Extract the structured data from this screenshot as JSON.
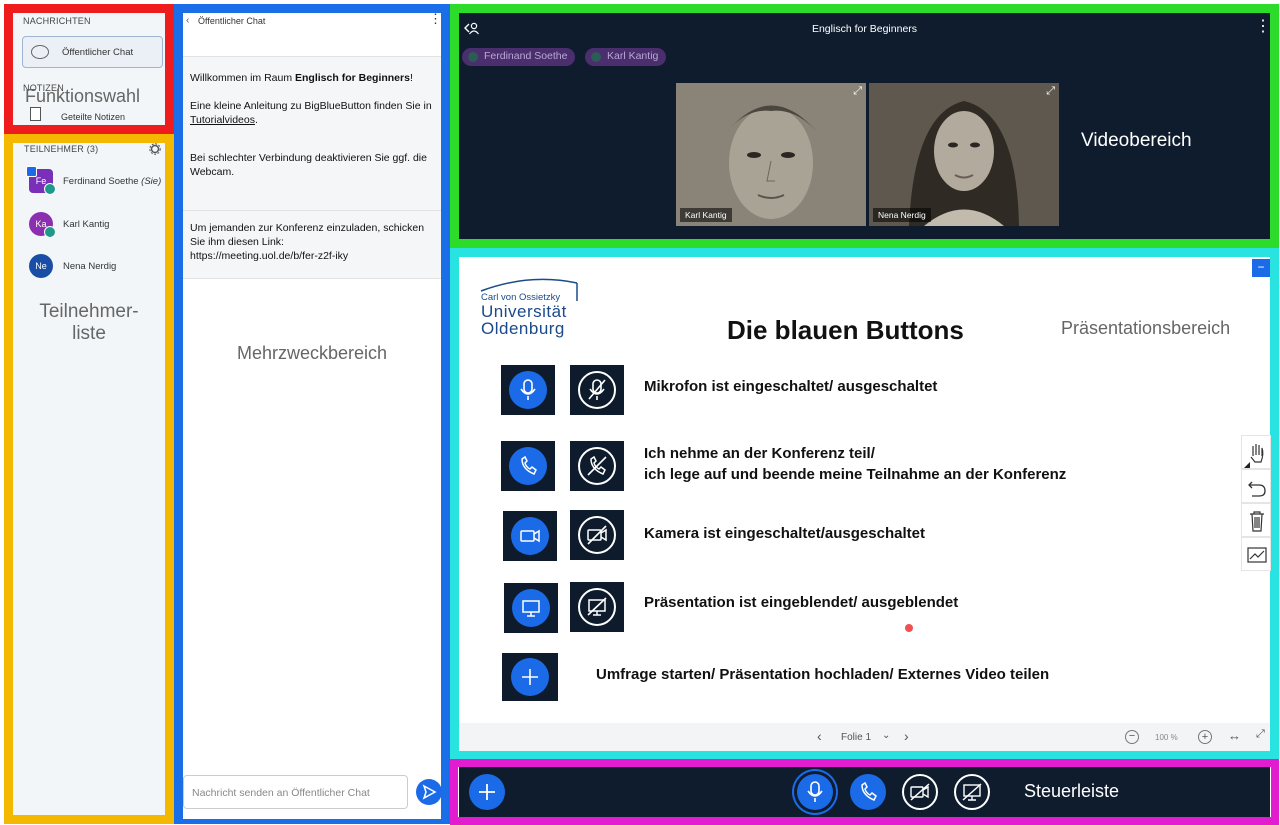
{
  "nav": {
    "messages_title": "NACHRICHTEN",
    "public_chat": "Öffentlicher Chat",
    "notes_title": "NOTIZEN",
    "shared_notes": "Geteilte Notizen",
    "overlay_label": "Funktionswahl",
    "participants_title": "TEILNEHMER (3)",
    "participants_label": "Teilnehmer-\nliste",
    "users": [
      {
        "initials": "Fe",
        "name": "Ferdinand Soethe",
        "suffix": "(Sie)",
        "color": "#7a2fb8"
      },
      {
        "initials": "Ka",
        "name": "Karl Kantig",
        "suffix": "",
        "color": "#8b2fb0"
      },
      {
        "initials": "Ne",
        "name": "Nena Nerdig",
        "suffix": "",
        "color": "#1a4da5"
      }
    ]
  },
  "chat": {
    "header": "Öffentlicher Chat",
    "welcome_prefix": "Willkommen im Raum ",
    "room_name": "Englisch for Beginners",
    "welcome_suffix": "!",
    "guide_prefix": "Eine kleine Anleitung zu BigBlueButton finden Sie in ",
    "guide_link": "Tutorialvideos",
    "guide_suffix": ".",
    "tip": "Bei schlechter Verbindung deaktivieren Sie ggf. die Webcam.",
    "invite_text": "Um jemanden zur Konferenz einzuladen, schicken Sie ihm diesen Link:",
    "invite_link": "https://meeting.uol.de/b/fer-z2f-iky",
    "area_label": "Mehrzweckbereich",
    "input_placeholder": "Nachricht senden an Öffentlicher Chat"
  },
  "video": {
    "title": "Englisch for Beginners",
    "talkers": [
      "Ferdinand Soethe",
      "Karl Kantig"
    ],
    "tiles": [
      "Karl Kantig",
      "Nena Nerdig"
    ],
    "area_label": "Videobereich"
  },
  "presentation": {
    "logo_line1": "Carl von Ossietzky",
    "logo_line2": "Universität",
    "logo_line3": "Oldenburg",
    "slide_title": "Die blauen Buttons",
    "area_label": "Präsentationsbereich",
    "rows": [
      "Mikrofon ist eingeschaltet/ ausgeschaltet",
      "Ich nehme an der Konferenz teil/",
      "ich lege auf und beende meine Teilnahme an der Konferenz",
      "Kamera ist eingeschaltet/ausgeschaltet",
      "Präsentation ist eingeblendet/  ausgeblendet",
      "Umfrage starten/ Präsentation hochladen/ Externes Video teilen"
    ],
    "slide_label": "Folie 1",
    "zoom": "100 %"
  },
  "controls": {
    "area_label": "Steuerleiste"
  },
  "colors": {
    "accent": "#1b6be8",
    "dark": "#0f1c2e"
  }
}
